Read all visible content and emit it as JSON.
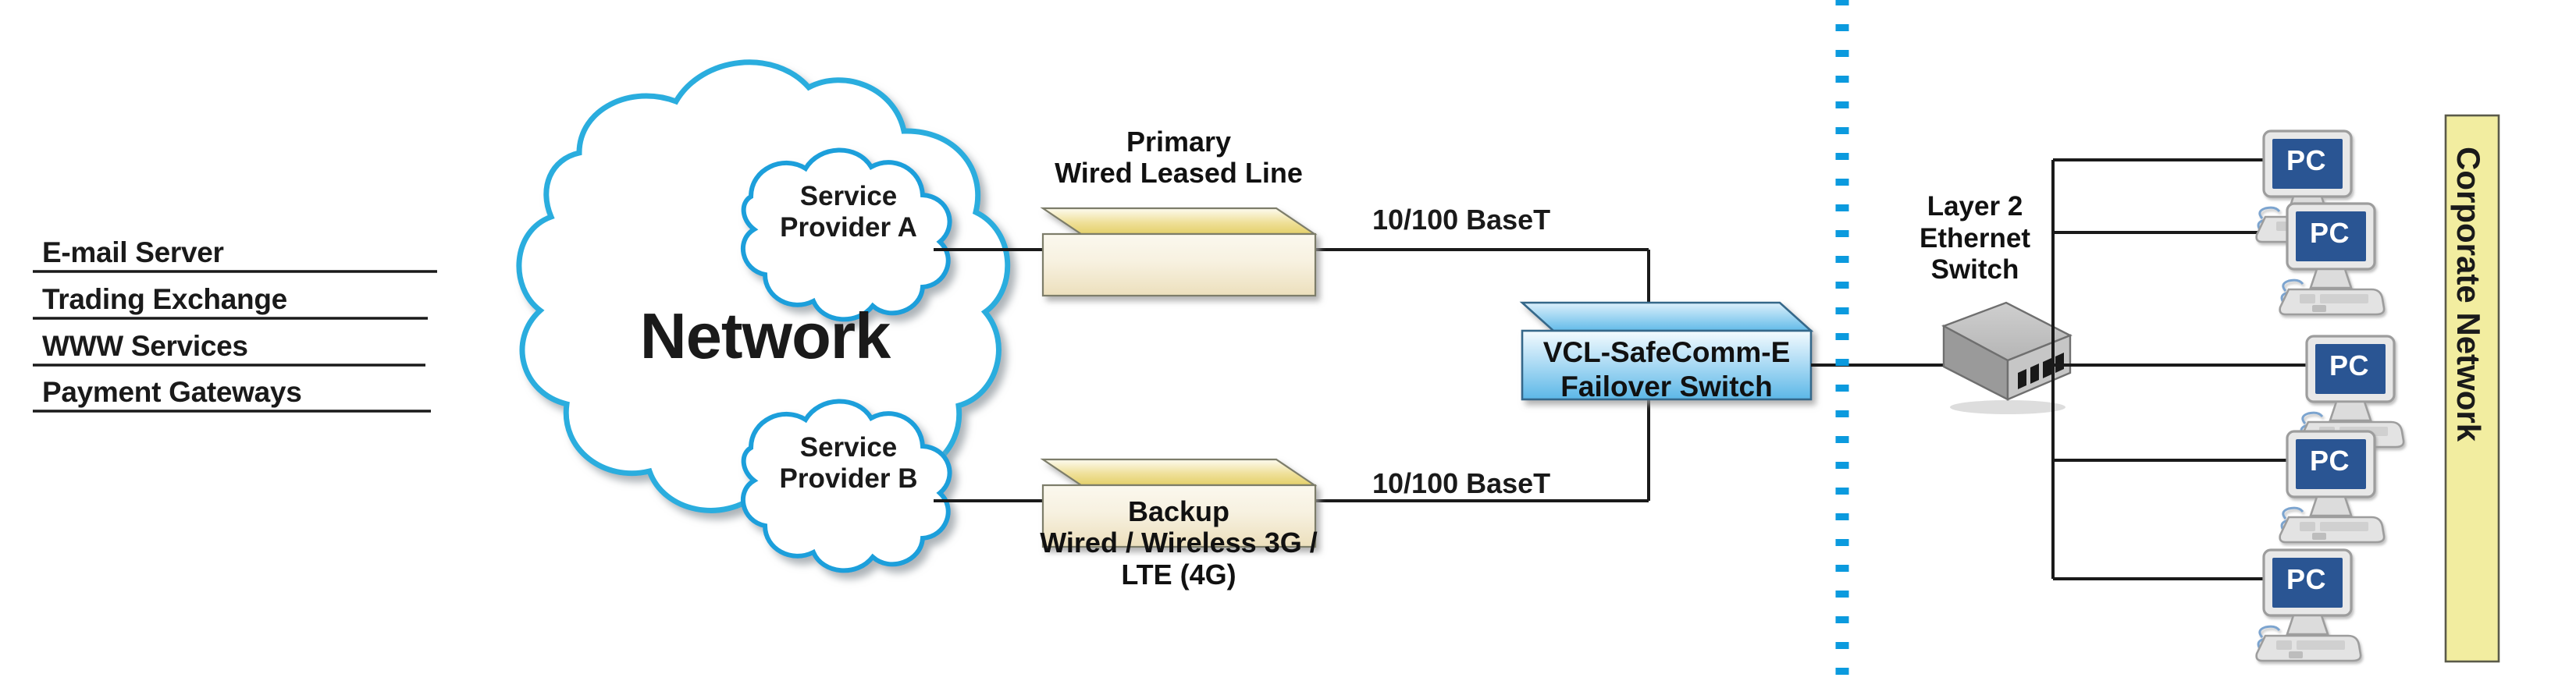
{
  "diagram": {
    "title": "VCL-SafeComm-E Failover Switch Network Topology",
    "colors": {
      "cloud_outline": "#1a9fdb",
      "router_body": "#f3ead0",
      "router_top": "#e8d87f",
      "failover_blue_top": "#eaf6fd",
      "failover_blue_bottom": "#5fb9e8",
      "switch_gray": "#b8b8b8",
      "pc_screen": "#2a5493",
      "corporate_yellow": "#f2eda0",
      "divider_blue": "#0b9ade",
      "line_black": "#1a1a1a"
    },
    "left_services": [
      {
        "label": "E-mail Server"
      },
      {
        "label": "Trading Exchange"
      },
      {
        "label": "WWW Services"
      },
      {
        "label": "Payment Gateways"
      }
    ],
    "network_cloud": {
      "label": "Network"
    },
    "service_clouds": [
      {
        "id": "provider-a",
        "line1": "Service",
        "line2": "Provider A"
      },
      {
        "id": "provider-b",
        "line1": "Service",
        "line2": "Provider B"
      }
    ],
    "routers": [
      {
        "id": "primary-router",
        "caption_lines": [
          "Primary",
          "Wired Leased Line"
        ],
        "caption_position": "above",
        "link_label": "10/100 BaseT"
      },
      {
        "id": "backup-router",
        "caption_lines": [
          "Backup",
          "Wired / Wireless 3G /",
          "LTE (4G)"
        ],
        "caption_position": "below",
        "link_label": "10/100 BaseT"
      }
    ],
    "failover_switch": {
      "line1": "VCL-SafeComm-E",
      "line2": "Failover Switch"
    },
    "ethernet_switch": {
      "caption_lines": [
        "Layer 2",
        "Ethernet",
        "Switch"
      ]
    },
    "workstations": [
      {
        "id": "pc-1",
        "label": "PC"
      },
      {
        "id": "pc-2",
        "label": "PC"
      },
      {
        "id": "pc-3",
        "label": "PC"
      },
      {
        "id": "pc-4",
        "label": "PC"
      },
      {
        "id": "pc-5",
        "label": "PC"
      }
    ],
    "corporate_network": {
      "label": "Corporate Network"
    },
    "divider": {
      "name": "dotted-boundary",
      "orientation": "vertical"
    }
  }
}
